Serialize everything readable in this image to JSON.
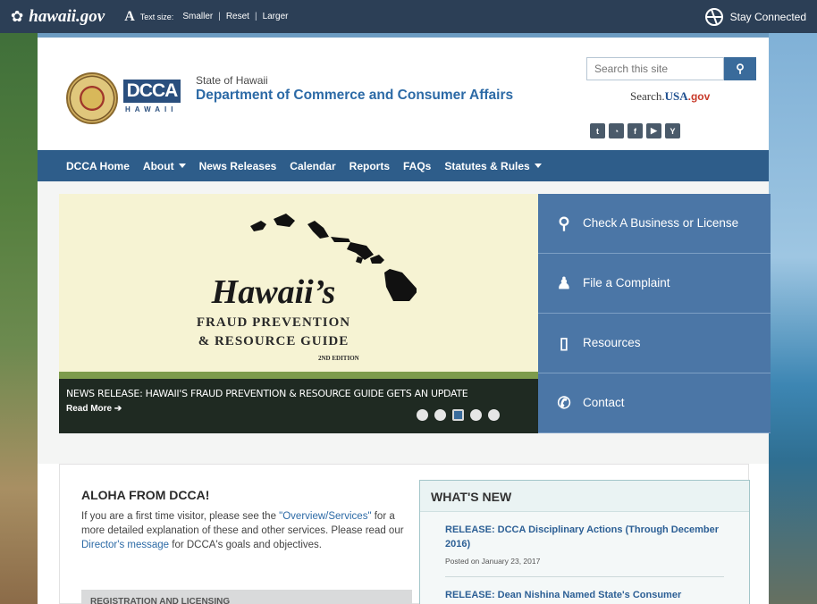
{
  "govbar": {
    "site_name": "hawaii.gov",
    "text_size_label": "Text size:",
    "smaller": "Smaller",
    "reset": "Reset",
    "larger": "Larger",
    "stay_connected": "Stay Connected"
  },
  "header": {
    "dcca_logo": "DCCA",
    "dcca_logo_sub": "HAWAII",
    "state_line": "State of Hawaii",
    "department": "Department of Commerce and Consumer Affairs",
    "search_placeholder": "Search this site",
    "search_usa_prefix": "Search.",
    "search_usa_mid": "USA",
    "search_usa_suffix": ".gov",
    "social_icons": [
      "twitter-icon",
      "rss-icon",
      "facebook-icon",
      "video-icon",
      "youtube-icon"
    ]
  },
  "nav": {
    "items": [
      {
        "label": "DCCA Home",
        "dropdown": false
      },
      {
        "label": "About",
        "dropdown": true
      },
      {
        "label": "News Releases",
        "dropdown": false
      },
      {
        "label": "Calendar",
        "dropdown": false
      },
      {
        "label": "Reports",
        "dropdown": false
      },
      {
        "label": "FAQs",
        "dropdown": false
      },
      {
        "label": "Statutes & Rules",
        "dropdown": true
      }
    ]
  },
  "slider": {
    "title": "Hawaii’s",
    "subtitle_1": "FRAUD PREVENTION",
    "subtitle_2": "& RESOURCE GUIDE",
    "edition": "2ND EDITION",
    "caption": "NEWS RELEASE: HAWAII'S FRAUD PREVENTION & RESOURCE GUIDE GETS AN UPDATE",
    "read_more": "Read More",
    "dot_count": 5,
    "active_dot": 3
  },
  "quicklinks": [
    {
      "label": "Check A Business or License",
      "icon": "search-icon"
    },
    {
      "label": "File a Complaint",
      "icon": "people-icon"
    },
    {
      "label": "Resources",
      "icon": "document-icon"
    },
    {
      "label": "Contact",
      "icon": "phone-icon"
    }
  ],
  "aloha": {
    "heading": "ALOHA FROM DCCA!",
    "p1": "If you are a first time visitor, please see the ",
    "p1_link": "\"Overview/Services\"",
    "p2": " for a more detailed explanation of these and other services. Please read our ",
    "p2_link": "Director's message",
    "p3": " for DCCA's goals and objectives.",
    "reg_bar": "REGISTRATION AND LICENSING"
  },
  "whats_new": {
    "heading": "WHAT'S NEW",
    "items": [
      {
        "title": "RELEASE: DCCA Disciplinary Actions (Through December 2016)",
        "date": "Posted on January 23, 2017"
      },
      {
        "title": "RELEASE: Dean Nishina Named State's Consumer",
        "date": ""
      }
    ]
  },
  "colors": {
    "govbar": "#2c3f56",
    "nav": "#2e5d8a",
    "quicklink": "#4b76a6",
    "link": "#2c6aa6"
  }
}
